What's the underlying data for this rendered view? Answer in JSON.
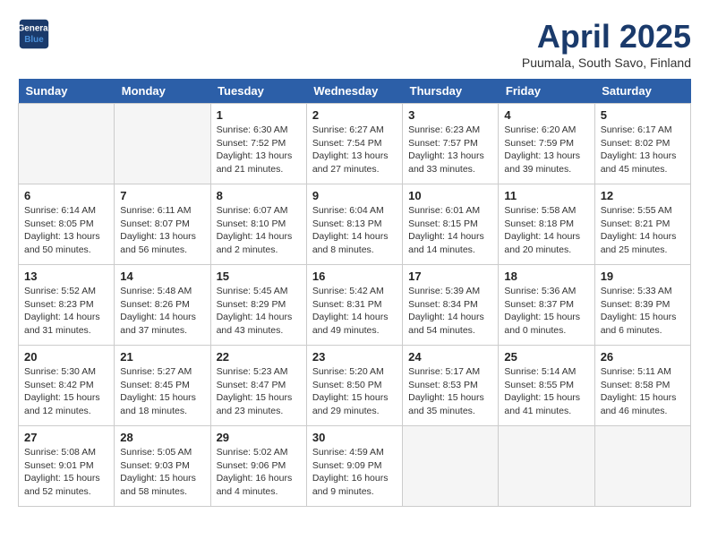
{
  "header": {
    "logo_line1": "General",
    "logo_line2": "Blue",
    "title": "April 2025",
    "subtitle": "Puumala, South Savo, Finland"
  },
  "weekdays": [
    "Sunday",
    "Monday",
    "Tuesday",
    "Wednesday",
    "Thursday",
    "Friday",
    "Saturday"
  ],
  "weeks": [
    [
      {
        "day": "",
        "info": ""
      },
      {
        "day": "",
        "info": ""
      },
      {
        "day": "1",
        "info": "Sunrise: 6:30 AM\nSunset: 7:52 PM\nDaylight: 13 hours\nand 21 minutes."
      },
      {
        "day": "2",
        "info": "Sunrise: 6:27 AM\nSunset: 7:54 PM\nDaylight: 13 hours\nand 27 minutes."
      },
      {
        "day": "3",
        "info": "Sunrise: 6:23 AM\nSunset: 7:57 PM\nDaylight: 13 hours\nand 33 minutes."
      },
      {
        "day": "4",
        "info": "Sunrise: 6:20 AM\nSunset: 7:59 PM\nDaylight: 13 hours\nand 39 minutes."
      },
      {
        "day": "5",
        "info": "Sunrise: 6:17 AM\nSunset: 8:02 PM\nDaylight: 13 hours\nand 45 minutes."
      }
    ],
    [
      {
        "day": "6",
        "info": "Sunrise: 6:14 AM\nSunset: 8:05 PM\nDaylight: 13 hours\nand 50 minutes."
      },
      {
        "day": "7",
        "info": "Sunrise: 6:11 AM\nSunset: 8:07 PM\nDaylight: 13 hours\nand 56 minutes."
      },
      {
        "day": "8",
        "info": "Sunrise: 6:07 AM\nSunset: 8:10 PM\nDaylight: 14 hours\nand 2 minutes."
      },
      {
        "day": "9",
        "info": "Sunrise: 6:04 AM\nSunset: 8:13 PM\nDaylight: 14 hours\nand 8 minutes."
      },
      {
        "day": "10",
        "info": "Sunrise: 6:01 AM\nSunset: 8:15 PM\nDaylight: 14 hours\nand 14 minutes."
      },
      {
        "day": "11",
        "info": "Sunrise: 5:58 AM\nSunset: 8:18 PM\nDaylight: 14 hours\nand 20 minutes."
      },
      {
        "day": "12",
        "info": "Sunrise: 5:55 AM\nSunset: 8:21 PM\nDaylight: 14 hours\nand 25 minutes."
      }
    ],
    [
      {
        "day": "13",
        "info": "Sunrise: 5:52 AM\nSunset: 8:23 PM\nDaylight: 14 hours\nand 31 minutes."
      },
      {
        "day": "14",
        "info": "Sunrise: 5:48 AM\nSunset: 8:26 PM\nDaylight: 14 hours\nand 37 minutes."
      },
      {
        "day": "15",
        "info": "Sunrise: 5:45 AM\nSunset: 8:29 PM\nDaylight: 14 hours\nand 43 minutes."
      },
      {
        "day": "16",
        "info": "Sunrise: 5:42 AM\nSunset: 8:31 PM\nDaylight: 14 hours\nand 49 minutes."
      },
      {
        "day": "17",
        "info": "Sunrise: 5:39 AM\nSunset: 8:34 PM\nDaylight: 14 hours\nand 54 minutes."
      },
      {
        "day": "18",
        "info": "Sunrise: 5:36 AM\nSunset: 8:37 PM\nDaylight: 15 hours\nand 0 minutes."
      },
      {
        "day": "19",
        "info": "Sunrise: 5:33 AM\nSunset: 8:39 PM\nDaylight: 15 hours\nand 6 minutes."
      }
    ],
    [
      {
        "day": "20",
        "info": "Sunrise: 5:30 AM\nSunset: 8:42 PM\nDaylight: 15 hours\nand 12 minutes."
      },
      {
        "day": "21",
        "info": "Sunrise: 5:27 AM\nSunset: 8:45 PM\nDaylight: 15 hours\nand 18 minutes."
      },
      {
        "day": "22",
        "info": "Sunrise: 5:23 AM\nSunset: 8:47 PM\nDaylight: 15 hours\nand 23 minutes."
      },
      {
        "day": "23",
        "info": "Sunrise: 5:20 AM\nSunset: 8:50 PM\nDaylight: 15 hours\nand 29 minutes."
      },
      {
        "day": "24",
        "info": "Sunrise: 5:17 AM\nSunset: 8:53 PM\nDaylight: 15 hours\nand 35 minutes."
      },
      {
        "day": "25",
        "info": "Sunrise: 5:14 AM\nSunset: 8:55 PM\nDaylight: 15 hours\nand 41 minutes."
      },
      {
        "day": "26",
        "info": "Sunrise: 5:11 AM\nSunset: 8:58 PM\nDaylight: 15 hours\nand 46 minutes."
      }
    ],
    [
      {
        "day": "27",
        "info": "Sunrise: 5:08 AM\nSunset: 9:01 PM\nDaylight: 15 hours\nand 52 minutes."
      },
      {
        "day": "28",
        "info": "Sunrise: 5:05 AM\nSunset: 9:03 PM\nDaylight: 15 hours\nand 58 minutes."
      },
      {
        "day": "29",
        "info": "Sunrise: 5:02 AM\nSunset: 9:06 PM\nDaylight: 16 hours\nand 4 minutes."
      },
      {
        "day": "30",
        "info": "Sunrise: 4:59 AM\nSunset: 9:09 PM\nDaylight: 16 hours\nand 9 minutes."
      },
      {
        "day": "",
        "info": ""
      },
      {
        "day": "",
        "info": ""
      },
      {
        "day": "",
        "info": ""
      }
    ]
  ]
}
